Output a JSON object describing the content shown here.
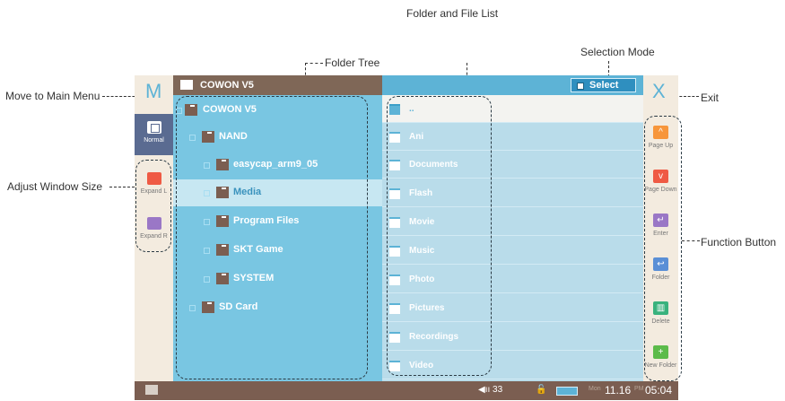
{
  "callouts": {
    "folder_file_list": "Folder and File List",
    "selection_mode": "Selection Mode",
    "folder_tree": "Folder Tree",
    "main_menu": "Move to Main Menu",
    "exit": "Exit",
    "adjust_window": "Adjust Window Size",
    "function_button": "Function Button"
  },
  "device": {
    "title": "COWON V5",
    "select_label": "Select",
    "m_label": "M",
    "x_label": "X",
    "left_buttons": [
      {
        "label": "Normal",
        "color": "#ffffff"
      },
      {
        "label": "Expand L",
        "color": "#ef5a44"
      },
      {
        "label": "Expand R",
        "color": "#9a77c6"
      }
    ],
    "tree": [
      {
        "label": "COWON V5"
      },
      {
        "label": "NAND"
      },
      {
        "label": "easycap_arm9_05"
      },
      {
        "label": "Media"
      },
      {
        "label": "Program Files"
      },
      {
        "label": "SKT Game"
      },
      {
        "label": "SYSTEM"
      },
      {
        "label": "SD Card"
      }
    ],
    "list": [
      "..",
      "Ani",
      "Documents",
      "Flash",
      "Movie",
      "Music",
      "Photo",
      "Pictures",
      "Recordings",
      "Video"
    ],
    "right_buttons": [
      {
        "label": "Page Up",
        "color": "#f7963b",
        "glyph": "^"
      },
      {
        "label": "Page Down",
        "color": "#ef5a44",
        "glyph": "v"
      },
      {
        "label": "Enter",
        "color": "#9a77c6",
        "glyph": "↵"
      },
      {
        "label": "Folder",
        "color": "#5a8fd6",
        "glyph": "↩"
      },
      {
        "label": "Delete",
        "color": "#39b27d",
        "glyph": "▥"
      },
      {
        "label": "New Folder",
        "color": "#5cbb4a",
        "glyph": "+"
      }
    ],
    "status": {
      "volume": "◀ıı 33",
      "day": "Mon",
      "date": "11.16",
      "ampm": "PM",
      "time": "05:04"
    }
  }
}
